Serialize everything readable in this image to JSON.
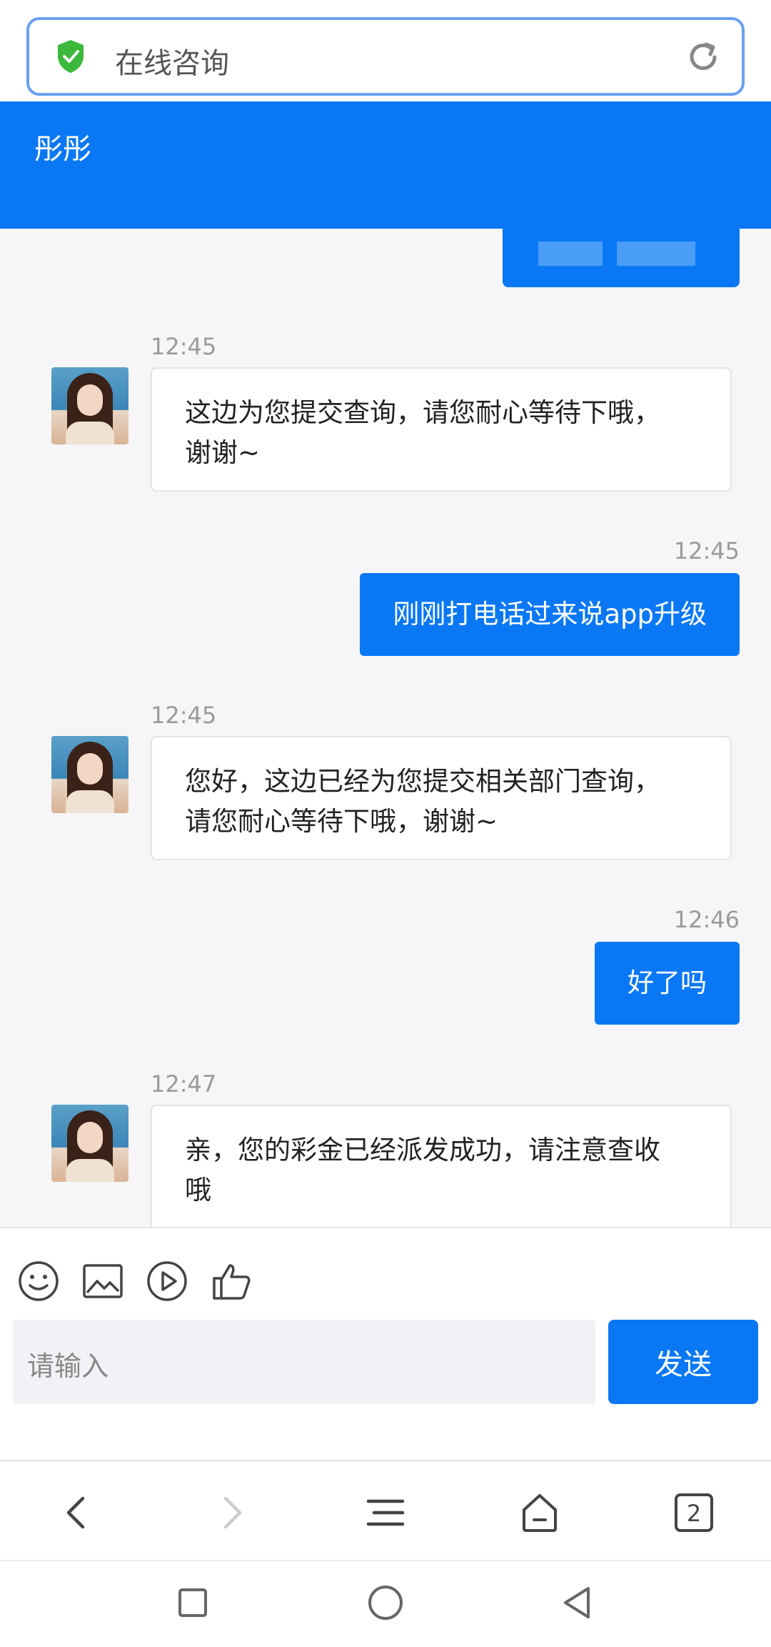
{
  "address_bar": {
    "title": "在线咨询",
    "icons": [
      "shield-check-icon",
      "reload-icon"
    ],
    "shield_color": "#3cb83c"
  },
  "header": {
    "name": "彤彤",
    "background": "#0a78f5"
  },
  "messages": [
    {
      "side": "in",
      "time": "12:45",
      "text_lines": [
        "这边为您提交查询，请您耐心等待下哦，",
        "谢谢~"
      ]
    },
    {
      "side": "out",
      "time": "12:45",
      "text": "刚刚打电话过来说app升级"
    },
    {
      "side": "in",
      "time": "12:45",
      "text_lines": [
        "您好，这边已经为您提交相关部门查询，",
        "请您耐心等待下哦，谢谢~"
      ]
    },
    {
      "side": "out",
      "time": "12:46",
      "text": "好了吗"
    },
    {
      "side": "in",
      "time": "12:47",
      "text_lines": [
        "亲，您的彩金已经派发成功，请注意查收",
        "哦"
      ]
    }
  ],
  "composer": {
    "tools": [
      "emoji-icon",
      "image-icon",
      "video-icon",
      "thumbs-up-icon"
    ],
    "placeholder": "请输入",
    "send_label": "发送"
  },
  "browser_nav": {
    "tab_count": "2",
    "icons": [
      "back-icon",
      "forward-icon",
      "menu-icon",
      "home-icon",
      "tabs-icon"
    ]
  },
  "system_nav": {
    "icons": [
      "recent-apps-icon",
      "home-circle-icon",
      "back-triangle-icon"
    ]
  }
}
